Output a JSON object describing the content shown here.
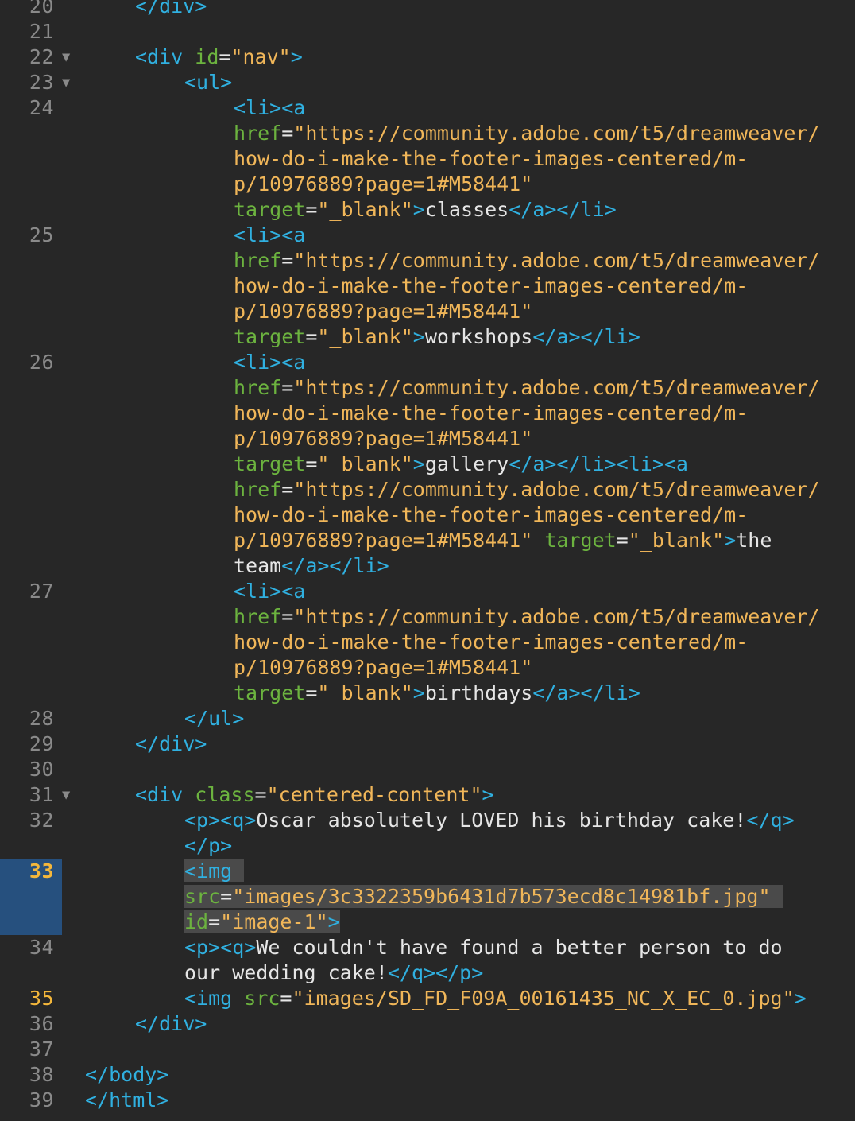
{
  "editor": {
    "theme_colors": {
      "background": "#272727",
      "line_number": "#8a8a8a",
      "line_number_highlight": "#f4b73b",
      "selection_gutter": "#26507e",
      "tag": "#30b0e0",
      "attribute": "#6cb33f",
      "string": "#f0b659",
      "text": "#e6e6e6"
    },
    "lines": [
      {
        "num": "20",
        "fold": "",
        "indent": 2,
        "tokens": [
          {
            "t": "tag",
            "v": "</div>"
          }
        ]
      },
      {
        "num": "21",
        "fold": "",
        "indent": 0,
        "tokens": []
      },
      {
        "num": "22",
        "fold": "▼",
        "indent": 2,
        "tokens": [
          {
            "t": "tag",
            "v": "<div "
          },
          {
            "t": "attr",
            "v": "id"
          },
          {
            "t": "eq",
            "v": "="
          },
          {
            "t": "str",
            "v": "\"nav\""
          },
          {
            "t": "tag",
            "v": ">"
          }
        ]
      },
      {
        "num": "23",
        "fold": "▼",
        "indent": 3,
        "tokens": [
          {
            "t": "tag",
            "v": "<ul>"
          }
        ]
      },
      {
        "num": "24",
        "fold": "",
        "indent": 4,
        "tokens": [
          {
            "t": "tag",
            "v": "<li><a"
          }
        ]
      },
      {
        "num": "",
        "fold": "",
        "indent": 4,
        "tokens": [
          {
            "t": "attr",
            "v": "href"
          },
          {
            "t": "eq",
            "v": "="
          },
          {
            "t": "str",
            "v": "\"https://community.adobe.com/t5/dreamweaver/"
          }
        ]
      },
      {
        "num": "",
        "fold": "",
        "indent": 4,
        "tokens": [
          {
            "t": "str",
            "v": "how-do-i-make-the-footer-images-centered/m-"
          }
        ]
      },
      {
        "num": "",
        "fold": "",
        "indent": 4,
        "tokens": [
          {
            "t": "str",
            "v": "p/10976889?page=1#M58441\""
          }
        ]
      },
      {
        "num": "",
        "fold": "",
        "indent": 4,
        "tokens": [
          {
            "t": "attr",
            "v": "target"
          },
          {
            "t": "eq",
            "v": "="
          },
          {
            "t": "str",
            "v": "\"_blank\""
          },
          {
            "t": "tag",
            "v": ">"
          },
          {
            "t": "text",
            "v": "classes"
          },
          {
            "t": "tag",
            "v": "</a></li>"
          }
        ]
      },
      {
        "num": "25",
        "fold": "",
        "indent": 4,
        "tokens": [
          {
            "t": "tag",
            "v": "<li><a"
          }
        ]
      },
      {
        "num": "",
        "fold": "",
        "indent": 4,
        "tokens": [
          {
            "t": "attr",
            "v": "href"
          },
          {
            "t": "eq",
            "v": "="
          },
          {
            "t": "str",
            "v": "\"https://community.adobe.com/t5/dreamweaver/"
          }
        ]
      },
      {
        "num": "",
        "fold": "",
        "indent": 4,
        "tokens": [
          {
            "t": "str",
            "v": "how-do-i-make-the-footer-images-centered/m-"
          }
        ]
      },
      {
        "num": "",
        "fold": "",
        "indent": 4,
        "tokens": [
          {
            "t": "str",
            "v": "p/10976889?page=1#M58441\""
          }
        ]
      },
      {
        "num": "",
        "fold": "",
        "indent": 4,
        "tokens": [
          {
            "t": "attr",
            "v": "target"
          },
          {
            "t": "eq",
            "v": "="
          },
          {
            "t": "str",
            "v": "\"_blank\""
          },
          {
            "t": "tag",
            "v": ">"
          },
          {
            "t": "text",
            "v": "workshops"
          },
          {
            "t": "tag",
            "v": "</a></li>"
          }
        ]
      },
      {
        "num": "26",
        "fold": "",
        "indent": 4,
        "tokens": [
          {
            "t": "tag",
            "v": "<li><a"
          }
        ]
      },
      {
        "num": "",
        "fold": "",
        "indent": 4,
        "tokens": [
          {
            "t": "attr",
            "v": "href"
          },
          {
            "t": "eq",
            "v": "="
          },
          {
            "t": "str",
            "v": "\"https://community.adobe.com/t5/dreamweaver/"
          }
        ]
      },
      {
        "num": "",
        "fold": "",
        "indent": 4,
        "tokens": [
          {
            "t": "str",
            "v": "how-do-i-make-the-footer-images-centered/m-"
          }
        ]
      },
      {
        "num": "",
        "fold": "",
        "indent": 4,
        "tokens": [
          {
            "t": "str",
            "v": "p/10976889?page=1#M58441\""
          }
        ]
      },
      {
        "num": "",
        "fold": "",
        "indent": 4,
        "tokens": [
          {
            "t": "attr",
            "v": "target"
          },
          {
            "t": "eq",
            "v": "="
          },
          {
            "t": "str",
            "v": "\"_blank\""
          },
          {
            "t": "tag",
            "v": ">"
          },
          {
            "t": "text",
            "v": "gallery"
          },
          {
            "t": "tag",
            "v": "</a></li><li><a"
          }
        ]
      },
      {
        "num": "",
        "fold": "",
        "indent": 4,
        "tokens": [
          {
            "t": "attr",
            "v": "href"
          },
          {
            "t": "eq",
            "v": "="
          },
          {
            "t": "str",
            "v": "\"https://community.adobe.com/t5/dreamweaver/"
          }
        ]
      },
      {
        "num": "",
        "fold": "",
        "indent": 4,
        "tokens": [
          {
            "t": "str",
            "v": "how-do-i-make-the-footer-images-centered/m-"
          }
        ]
      },
      {
        "num": "",
        "fold": "",
        "indent": 4,
        "tokens": [
          {
            "t": "str",
            "v": "p/10976889?page=1#M58441\""
          },
          {
            "t": "text",
            "v": " "
          },
          {
            "t": "attr",
            "v": "target"
          },
          {
            "t": "eq",
            "v": "="
          },
          {
            "t": "str",
            "v": "\"_blank\""
          },
          {
            "t": "tag",
            "v": ">"
          },
          {
            "t": "text",
            "v": "the"
          }
        ]
      },
      {
        "num": "",
        "fold": "",
        "indent": 4,
        "tokens": [
          {
            "t": "text",
            "v": "team"
          },
          {
            "t": "tag",
            "v": "</a></li>"
          }
        ]
      },
      {
        "num": "27",
        "fold": "",
        "indent": 4,
        "tokens": [
          {
            "t": "tag",
            "v": "<li><a"
          }
        ]
      },
      {
        "num": "",
        "fold": "",
        "indent": 4,
        "tokens": [
          {
            "t": "attr",
            "v": "href"
          },
          {
            "t": "eq",
            "v": "="
          },
          {
            "t": "str",
            "v": "\"https://community.adobe.com/t5/dreamweaver/"
          }
        ]
      },
      {
        "num": "",
        "fold": "",
        "indent": 4,
        "tokens": [
          {
            "t": "str",
            "v": "how-do-i-make-the-footer-images-centered/m-"
          }
        ]
      },
      {
        "num": "",
        "fold": "",
        "indent": 4,
        "tokens": [
          {
            "t": "str",
            "v": "p/10976889?page=1#M58441\""
          }
        ]
      },
      {
        "num": "",
        "fold": "",
        "indent": 4,
        "tokens": [
          {
            "t": "attr",
            "v": "target"
          },
          {
            "t": "eq",
            "v": "="
          },
          {
            "t": "str",
            "v": "\"_blank\""
          },
          {
            "t": "tag",
            "v": ">"
          },
          {
            "t": "text",
            "v": "birthdays"
          },
          {
            "t": "tag",
            "v": "</a></li>"
          }
        ]
      },
      {
        "num": "28",
        "fold": "",
        "indent": 3,
        "tokens": [
          {
            "t": "tag",
            "v": "</ul>"
          }
        ]
      },
      {
        "num": "29",
        "fold": "",
        "indent": 2,
        "tokens": [
          {
            "t": "tag",
            "v": "</div>"
          }
        ]
      },
      {
        "num": "30",
        "fold": "",
        "indent": 0,
        "tokens": []
      },
      {
        "num": "31",
        "fold": "▼",
        "indent": 2,
        "tokens": [
          {
            "t": "tag",
            "v": "<div "
          },
          {
            "t": "attr",
            "v": "class"
          },
          {
            "t": "eq",
            "v": "="
          },
          {
            "t": "str",
            "v": "\"centered-content\""
          },
          {
            "t": "tag",
            "v": ">"
          }
        ]
      },
      {
        "num": "32",
        "fold": "",
        "indent": 3,
        "tokens": [
          {
            "t": "tag",
            "v": "<p><q>"
          },
          {
            "t": "text",
            "v": "Oscar absolutely LOVED his birthday cake!"
          },
          {
            "t": "tag",
            "v": "</q>"
          }
        ]
      },
      {
        "num": "",
        "fold": "",
        "indent": 3,
        "tokens": [
          {
            "t": "tag",
            "v": "</p>"
          }
        ]
      },
      {
        "num": "33",
        "fold": "",
        "indent": 3,
        "sel": true,
        "numstyle": "hl",
        "tokens": [
          {
            "t": "tag",
            "v": "<img "
          }
        ]
      },
      {
        "num": "",
        "fold": "",
        "indent": 3,
        "sel": true,
        "tokens": [
          {
            "t": "attr",
            "v": "src"
          },
          {
            "t": "eq",
            "v": "="
          },
          {
            "t": "str",
            "v": "\"images/3c3322359b6431d7b573ecd8c14981bf.jpg\" "
          }
        ]
      },
      {
        "num": "",
        "fold": "",
        "indent": 3,
        "sel": true,
        "caret": 13,
        "tokens": [
          {
            "t": "attr",
            "v": "id"
          },
          {
            "t": "eq",
            "v": "="
          },
          {
            "t": "str",
            "v": "\"image-1\""
          },
          {
            "t": "tag",
            "v": ">"
          }
        ]
      },
      {
        "num": "34",
        "fold": "",
        "indent": 3,
        "tokens": [
          {
            "t": "tag",
            "v": "<p><q>"
          },
          {
            "t": "text",
            "v": "We couldn't have found a better person to do"
          }
        ]
      },
      {
        "num": "",
        "fold": "",
        "indent": 3,
        "tokens": [
          {
            "t": "text",
            "v": "our wedding cake!"
          },
          {
            "t": "tag",
            "v": "</q></p>"
          }
        ]
      },
      {
        "num": "35",
        "fold": "",
        "indent": 3,
        "numstyle": "mod",
        "tokens": [
          {
            "t": "tag",
            "v": "<img "
          },
          {
            "t": "attr",
            "v": "src"
          },
          {
            "t": "eq",
            "v": "="
          },
          {
            "t": "str",
            "v": "\"images/SD_FD_F09A_00161435_NC_X_EC_0.jpg\""
          },
          {
            "t": "tag",
            "v": ">"
          }
        ]
      },
      {
        "num": "36",
        "fold": "",
        "indent": 2,
        "tokens": [
          {
            "t": "tag",
            "v": "</div>"
          }
        ]
      },
      {
        "num": "37",
        "fold": "",
        "indent": 0,
        "tokens": []
      },
      {
        "num": "38",
        "fold": "",
        "indent": 1,
        "tokens": [
          {
            "t": "tag",
            "v": "</body>"
          }
        ]
      },
      {
        "num": "39",
        "fold": "",
        "indent": 1,
        "tokens": [
          {
            "t": "tag",
            "v": "</html>"
          }
        ]
      }
    ]
  }
}
